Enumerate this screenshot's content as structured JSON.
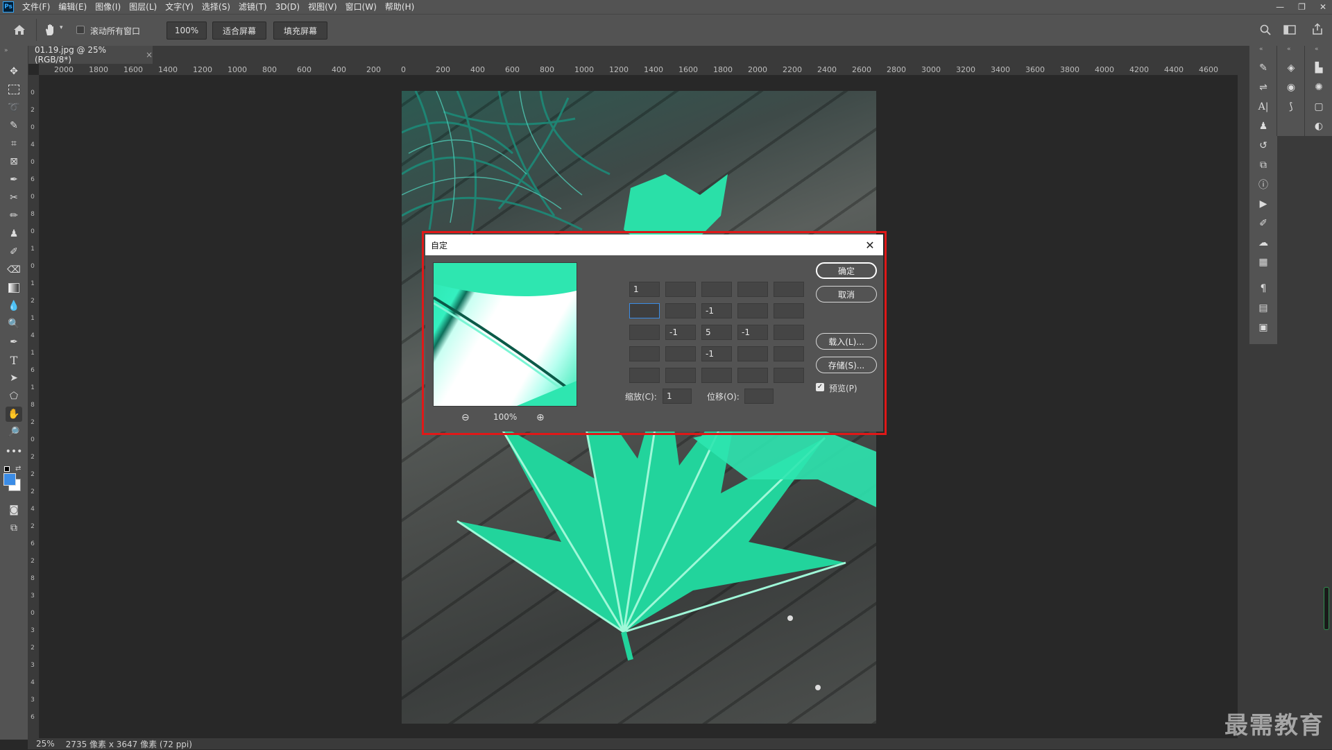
{
  "app": {
    "logo": "Ps"
  },
  "menu": [
    "文件(F)",
    "编辑(E)",
    "图像(I)",
    "图层(L)",
    "文字(Y)",
    "选择(S)",
    "滤镜(T)",
    "3D(D)",
    "视图(V)",
    "窗口(W)",
    "帮助(H)"
  ],
  "window_controls": {
    "minimize": "—",
    "restore": "❐",
    "close": "✕"
  },
  "options": {
    "scroll_all_label": "滚动所有窗口",
    "zoom_value": "100%",
    "fit_screen": "适合屏幕",
    "fill_screen": "填充屏幕"
  },
  "document_tab": {
    "title": "01.19.jpg @ 25%(RGB/8*)",
    "close": "×"
  },
  "ruler": {
    "h_labels": [
      "2000",
      "1800",
      "1600",
      "1400",
      "1200",
      "1000",
      "800",
      "600",
      "400",
      "200",
      "0",
      "200",
      "400",
      "600",
      "800",
      "1000",
      "1200",
      "1400",
      "1600",
      "1800",
      "2000",
      "2200",
      "2400",
      "2600",
      "2800",
      "3000",
      "3200",
      "3400",
      "3600",
      "3800",
      "4000",
      "4200",
      "4400",
      "4600"
    ],
    "v_labels": [
      "0",
      "2",
      "0",
      "4",
      "0",
      "6",
      "0",
      "8",
      "0",
      "1",
      "0",
      "1",
      "2",
      "1",
      "4",
      "1",
      "6",
      "1",
      "8",
      "2",
      "0",
      "2",
      "2",
      "2",
      "4",
      "2",
      "6",
      "2",
      "8",
      "3",
      "0",
      "3",
      "2",
      "3",
      "4",
      "3",
      "6"
    ]
  },
  "dialog": {
    "title": "自定",
    "close": "✕",
    "zoom_out_icon": "⊖",
    "zoom_value": "100%",
    "zoom_in_icon": "⊕",
    "kernel": [
      [
        "1",
        "",
        "",
        "",
        ""
      ],
      [
        "",
        "",
        "-1",
        "",
        ""
      ],
      [
        "",
        "-1",
        "5",
        "-1",
        ""
      ],
      [
        "",
        "",
        "-1",
        "",
        ""
      ],
      [
        "",
        "",
        "",
        "",
        ""
      ]
    ],
    "ok": "确定",
    "cancel": "取消",
    "load": "载入(L)...",
    "save": "存储(S)...",
    "preview_label": "预览(P)",
    "preview_checked": true,
    "scale_label": "缩放(C):",
    "scale_value": "1",
    "offset_label": "位移(O):",
    "offset_value": ""
  },
  "status": {
    "zoom": "25%",
    "info": "2735 像素 x 3647 像素 (72 ppi)"
  },
  "watermark": "最需教育",
  "colors": {
    "highlight": "#e01818",
    "foreground": "#3b8ce6",
    "background": "#ffffff"
  }
}
